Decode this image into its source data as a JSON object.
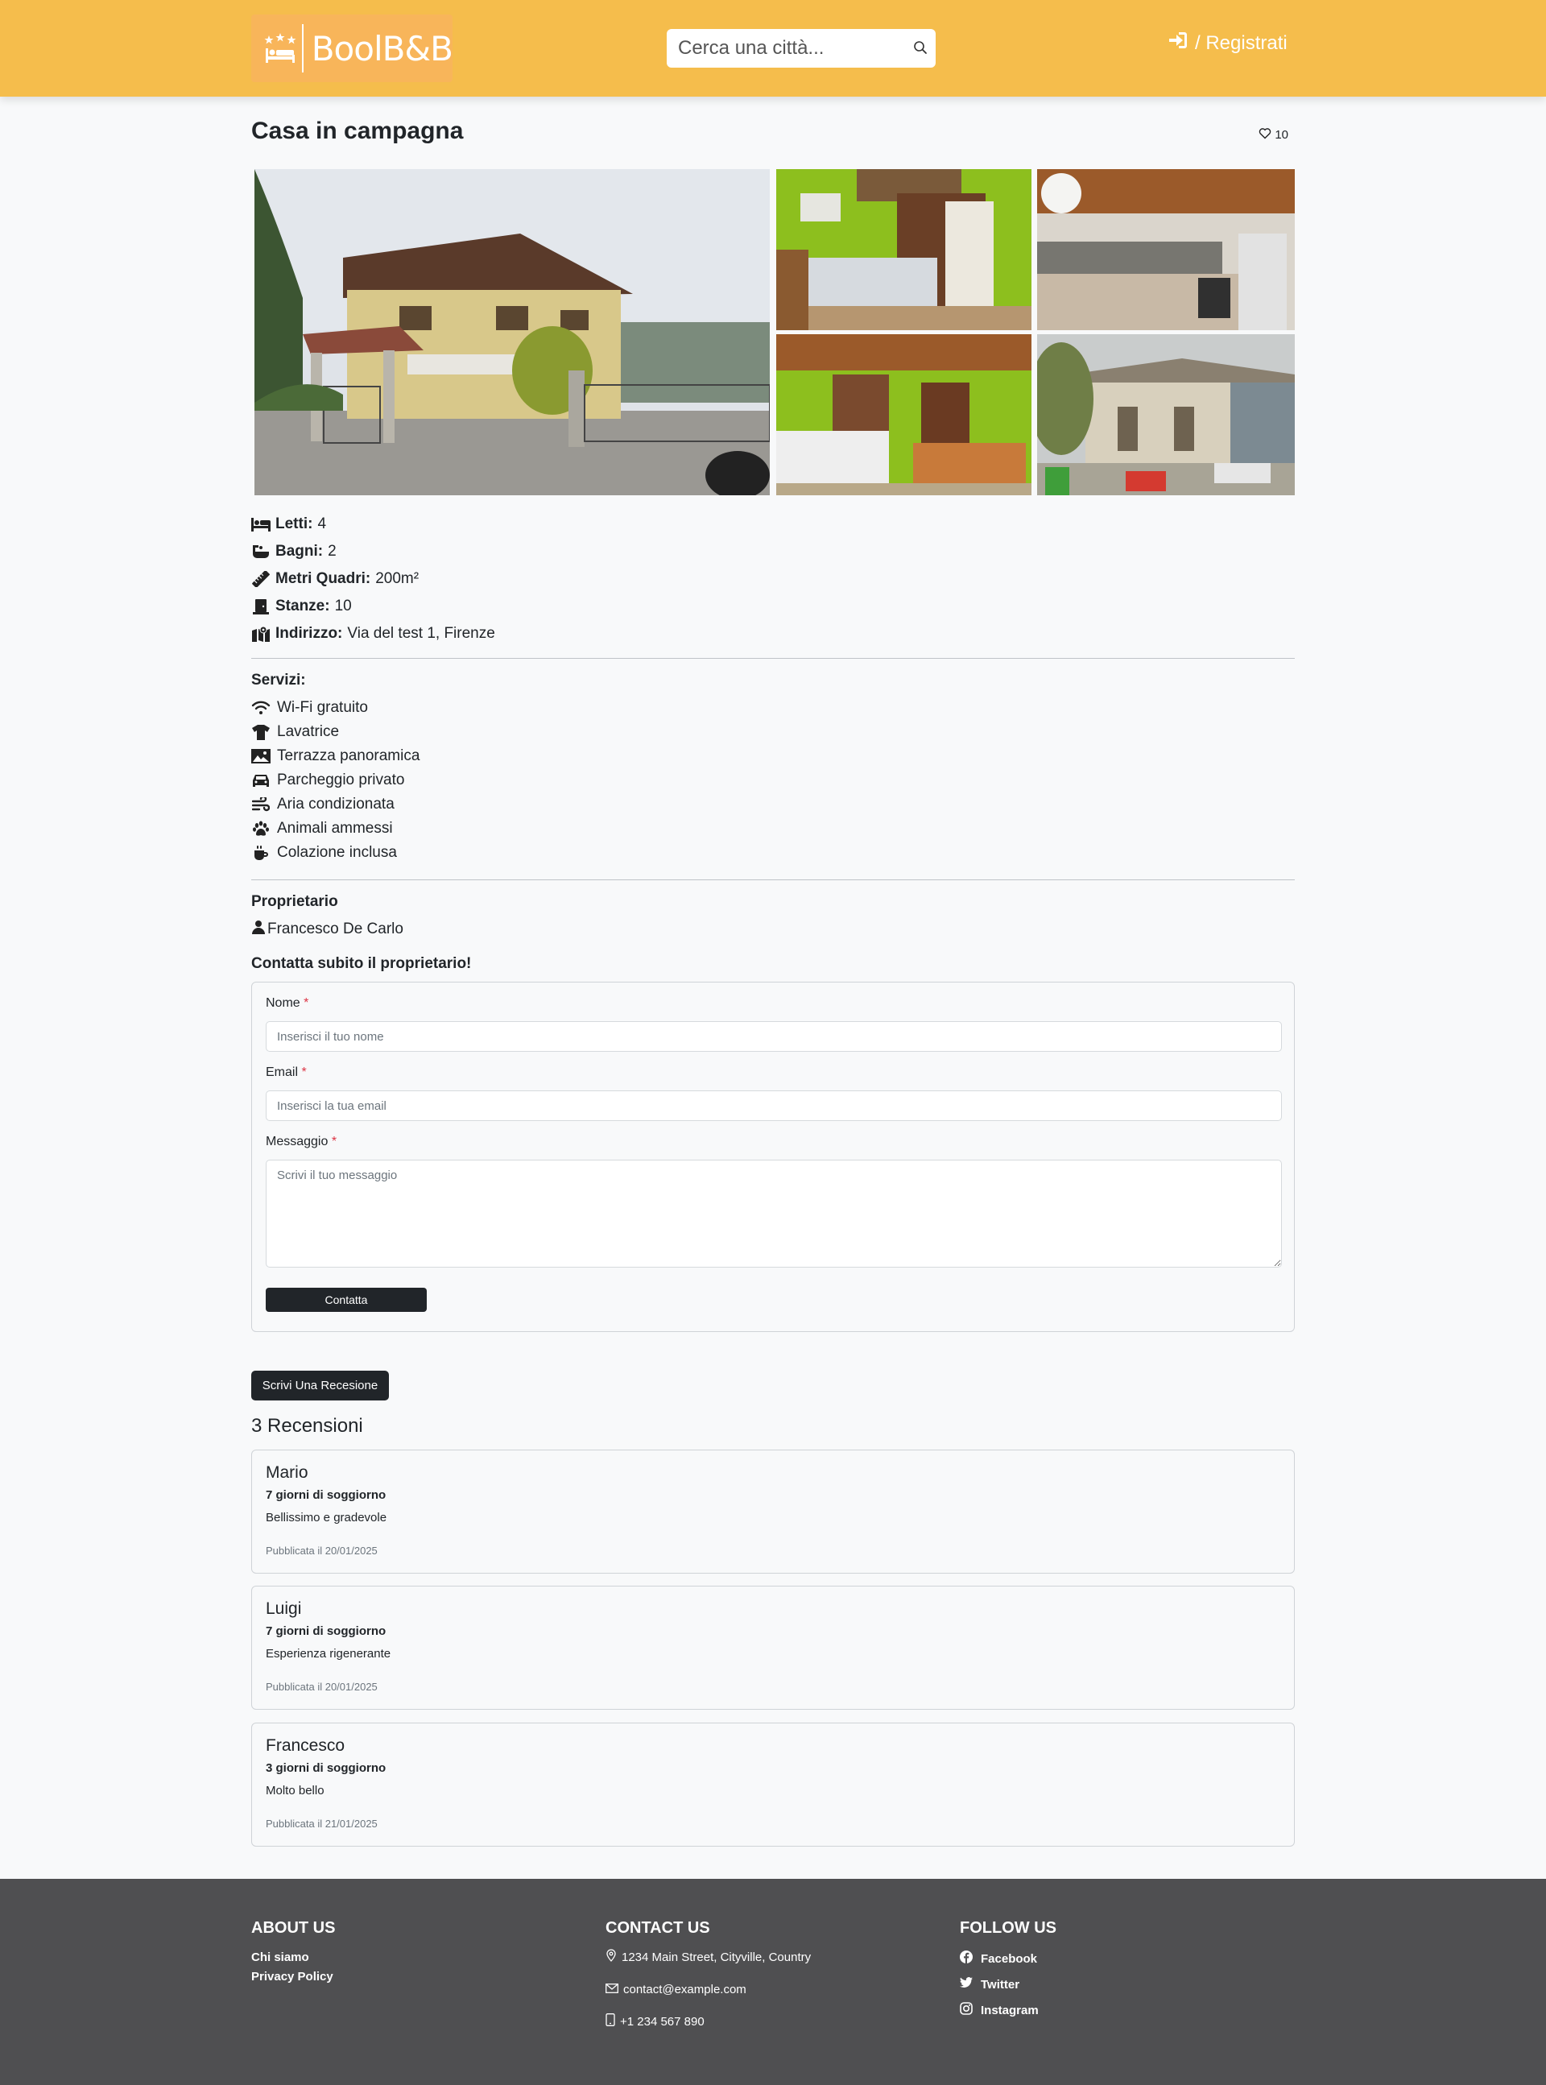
{
  "header": {
    "logo_text": "BoolB&B",
    "search_placeholder": "Cerca una città...",
    "login_label": "/ Registrati",
    "bg_color": "#f5bd4c"
  },
  "listing": {
    "title": "Casa in campagna",
    "likes": "10",
    "photos": [
      "Casa esterno",
      "Soggiorno",
      "Cucina",
      "Sala da pranzo",
      "Cortile"
    ],
    "details": [
      {
        "label": "Letti:",
        "value": "4",
        "icon": "bed-icon"
      },
      {
        "label": "Bagni:",
        "value": "2",
        "icon": "bath-icon"
      },
      {
        "label": "Metri Quadri:",
        "value": "200m²",
        "icon": "ruler-icon"
      },
      {
        "label": "Stanze:",
        "value": "10",
        "icon": "door-icon"
      },
      {
        "label": "Indirizzo:",
        "value": "Via del test 1, Firenze",
        "icon": "map-icon"
      }
    ],
    "services_title": "Servizi:",
    "services": [
      {
        "label": "Wi-Fi gratuito",
        "icon": "wifi-icon"
      },
      {
        "label": "Lavatrice",
        "icon": "shirt-icon"
      },
      {
        "label": "Terrazza panoramica",
        "icon": "landscape-icon"
      },
      {
        "label": "Parcheggio privato",
        "icon": "car-icon"
      },
      {
        "label": "Aria condizionata",
        "icon": "wind-icon"
      },
      {
        "label": "Animali ammessi",
        "icon": "paw-icon"
      },
      {
        "label": "Colazione inclusa",
        "icon": "coffee-icon"
      }
    ],
    "owner_title": "Proprietario",
    "owner_name": "Francesco De Carlo"
  },
  "contact": {
    "title": "Contatta subito il proprietario!",
    "name_label": "Nome",
    "name_placeholder": "Inserisci il tuo nome",
    "email_label": "Email",
    "email_placeholder": "Inserisci la tua email",
    "message_label": "Messaggio",
    "message_placeholder": "Scrivi il tuo messaggio",
    "required_mark": "*",
    "submit_label": "Contatta"
  },
  "reviews": {
    "write_label": "Scrivi Una Recesione",
    "count_title": "3 Recensioni",
    "items": [
      {
        "author": "Mario",
        "stay": "7 giorni di soggiorno",
        "text": "Bellissimo e gradevole",
        "date": "Pubblicata il 20/01/2025"
      },
      {
        "author": "Luigi",
        "stay": "7 giorni di soggiorno",
        "text": "Esperienza rigenerante",
        "date": "Pubblicata il 20/01/2025"
      },
      {
        "author": "Francesco",
        "stay": "3 giorni di soggiorno",
        "text": "Molto bello",
        "date": "Pubblicata il 21/01/2025"
      }
    ]
  },
  "footer": {
    "about_title": "ABOUT US",
    "about_links": [
      "Chi siamo",
      "Privacy Policy"
    ],
    "contact_title": "CONTACT US",
    "address": "1234 Main Street, Cityville, Country",
    "email": "contact@example.com",
    "phone": "+1 234 567 890",
    "follow_title": "FOLLOW US",
    "socials": [
      "Facebook",
      "Twitter",
      "Instagram"
    ]
  }
}
